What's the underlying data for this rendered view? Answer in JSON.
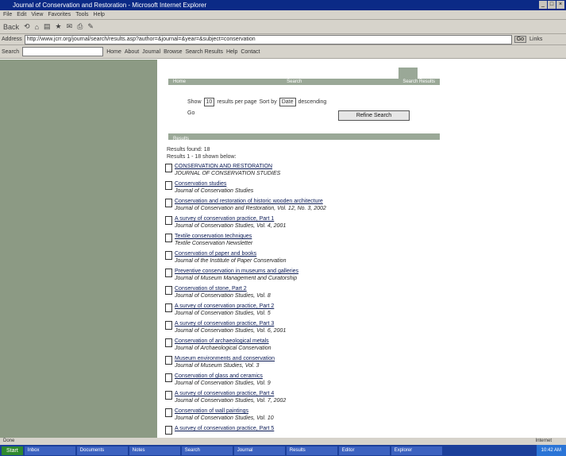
{
  "window": {
    "title": "Journal of Conservation and Restoration - Microsoft Internet Explorer",
    "controls": [
      "_",
      "□",
      "×"
    ]
  },
  "menu": [
    "File",
    "Edit",
    "View",
    "Favorites",
    "Tools",
    "Help"
  ],
  "toolbar": {
    "back": "Back",
    "items": [
      "⟲",
      "⌂",
      "▤",
      "★",
      "✉",
      "⎙",
      "✎"
    ]
  },
  "address": {
    "label": "Address",
    "value": "http://www.jcrr.org/journal/search/results.asp?author=&journal=&year=&subject=conservation",
    "go": "Go",
    "links": "Links"
  },
  "links_bar": {
    "label": "Search",
    "items": [
      "Home",
      "About",
      "Journal",
      "Browse",
      "Search Results",
      "Help",
      "Contact"
    ]
  },
  "main": {
    "tabs": [
      "Home",
      "Search",
      "Search Results"
    ],
    "row1": {
      "label": "Show",
      "count": "10",
      "per_page": "results per page",
      "sort_label": "Sort by",
      "sort_value": "Date",
      "order": "descending"
    },
    "row2": "Go",
    "button": "Refine Search",
    "section": "Results",
    "summary": {
      "line1": "Results found: 18",
      "line2": "Results 1 - 18 shown below:"
    },
    "results": [
      {
        "title": "CONSERVATION AND RESTORATION",
        "sub": "JOURNAL OF CONSERVATION STUDIES"
      },
      {
        "title": "Conservation studies",
        "sub": "Journal of Conservation Studies"
      },
      {
        "title": "Conservation and restoration of historic wooden architecture",
        "sub": "Journal of Conservation and Restoration, Vol. 12, No. 3, 2002"
      },
      {
        "title": "A survey of conservation practice, Part 1",
        "sub": "Journal of Conservation Studies, Vol. 4, 2001"
      },
      {
        "title": "Textile conservation techniques",
        "sub": "Textile Conservation Newsletter"
      },
      {
        "title": "Conservation of paper and books",
        "sub": "Journal of the Institute of Paper Conservation"
      },
      {
        "title": "Preventive conservation in museums and galleries",
        "sub": "Journal of Museum Management and Curatorship"
      },
      {
        "title": "Conservation of stone, Part 2",
        "sub": "Journal of Conservation Studies, Vol. 8"
      },
      {
        "title": "A survey of conservation practice, Part 2",
        "sub": "Journal of Conservation Studies, Vol. 5"
      },
      {
        "title": "A survey of conservation practice, Part 3",
        "sub": "Journal of Conservation Studies, Vol. 6, 2001"
      },
      {
        "title": "Conservation of archaeological metals",
        "sub": "Journal of Archaeological Conservation"
      },
      {
        "title": "Museum environments and conservation",
        "sub": "Journal of Museum Studies, Vol. 3"
      },
      {
        "title": "Conservation of glass and ceramics",
        "sub": "Journal of Conservation Studies, Vol. 9"
      },
      {
        "title": "A survey of conservation practice, Part 4",
        "sub": "Journal of Conservation Studies, Vol. 7, 2002"
      },
      {
        "title": "Conservation of wall paintings",
        "sub": "Journal of Conservation Studies, Vol. 10"
      },
      {
        "title": "A survey of conservation practice, Part 5",
        "sub": ""
      }
    ]
  },
  "status": {
    "left": "Done",
    "right": "Internet"
  },
  "taskbar": {
    "start": "Start",
    "tasks": [
      "Inbox",
      "Documents",
      "Notes",
      "Search",
      "Journal",
      "Results",
      "Editor",
      "Explorer"
    ],
    "clock": "10:42 AM"
  }
}
